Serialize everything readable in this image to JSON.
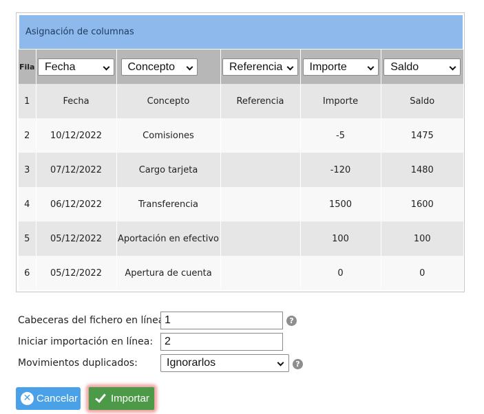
{
  "panel": {
    "title": "Asignación de columnas"
  },
  "column_selectors": {
    "row_label": "Fila",
    "columns": [
      {
        "value": "Fecha"
      },
      {
        "value": "Concepto"
      },
      {
        "value": "Referencia"
      },
      {
        "value": "Importe"
      },
      {
        "value": "Saldo"
      }
    ]
  },
  "rows": [
    {
      "fila": "1",
      "cells": [
        "Fecha",
        "Concepto",
        "Referencia",
        "Importe",
        "Saldo"
      ]
    },
    {
      "fila": "2",
      "cells": [
        "10/12/2022",
        "Comisiones",
        "",
        "-5",
        "1475"
      ]
    },
    {
      "fila": "3",
      "cells": [
        "07/12/2022",
        "Cargo tarjeta",
        "",
        "-120",
        "1480"
      ]
    },
    {
      "fila": "4",
      "cells": [
        "06/12/2022",
        "Transferencia",
        "",
        "1500",
        "1600"
      ]
    },
    {
      "fila": "5",
      "cells": [
        "05/12/2022",
        "Aportación en efectivo",
        "",
        "100",
        "100"
      ]
    },
    {
      "fila": "6",
      "cells": [
        "05/12/2022",
        "Apertura de cuenta",
        "",
        "0",
        "0"
      ]
    }
  ],
  "form": {
    "header_line_label": "Cabeceras del fichero en línea:",
    "header_line_value": "1",
    "start_line_label": "Iniciar importación en línea:",
    "start_line_value": "2",
    "duplicates_label": "Movimientos duplicados:",
    "duplicates_value": "Ignorarlos",
    "help_glyph": "?"
  },
  "buttons": {
    "cancel_label": "Cancelar",
    "import_label": "Importar",
    "cancel_color": "#4aa1e8",
    "import_color": "#4c9a48"
  }
}
